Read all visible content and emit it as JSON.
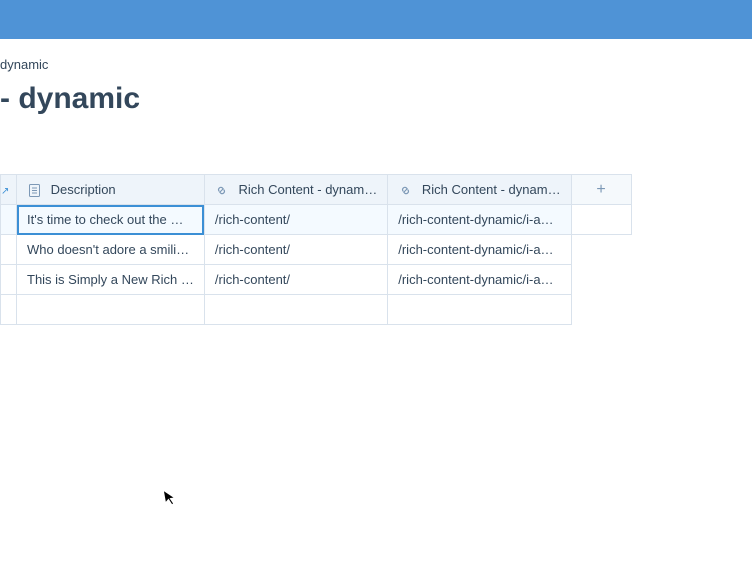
{
  "breadcrumb": "dynamic",
  "title_suffix": " - dynamic",
  "columns": {
    "description": "Description",
    "rc1": "Rich Content - dynam…",
    "rc2": "Rich Content - dynam…",
    "add": "+"
  },
  "stub_icon": "↗",
  "rows": [
    {
      "description": "It's time to check out the …",
      "rc1": "/rich-content/",
      "rc2": "/rich-content-dynamic/i-a…"
    },
    {
      "description": "Who doesn't adore a smili…",
      "rc1": "/rich-content/",
      "rc2": "/rich-content-dynamic/i-a…"
    },
    {
      "description": "This is Simply a New Rich …",
      "rc1": "/rich-content/",
      "rc2": "/rich-content-dynamic/i-a…"
    }
  ]
}
